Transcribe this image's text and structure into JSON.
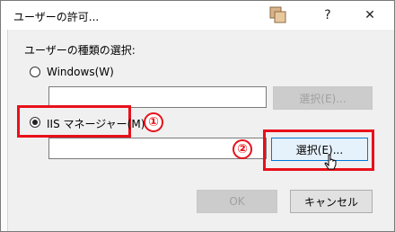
{
  "window": {
    "title": "ユーザーの許可..."
  },
  "titlebar": {
    "help_label": "?",
    "close_label": "✕"
  },
  "form": {
    "section_label": "ユーザーの種類の選択:",
    "windows_option": "Windows(W)",
    "windows_select_label": "選択(E)...",
    "iis_option": "IIS マネージャー(M)",
    "iis_select_label": "選択(E)...",
    "windows_value": "",
    "iis_value": ""
  },
  "selected_option": "IIS マネージャー(M)",
  "annotations": {
    "badge1": "①",
    "badge2": "②"
  },
  "footer": {
    "ok_label": "OK",
    "cancel_label": "キャンセル"
  },
  "colors": {
    "annotation_red": "#e8101a",
    "focus_blue": "#0078d7"
  }
}
